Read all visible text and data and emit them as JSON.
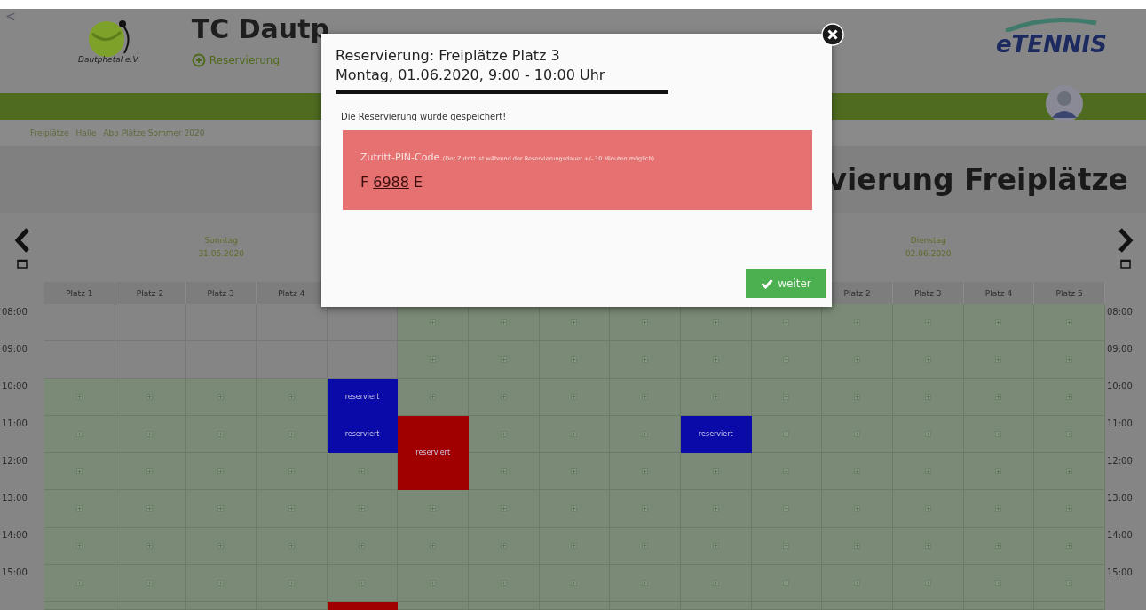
{
  "header": {
    "back": "<",
    "logo_text": "Dautphetal e.V.",
    "club_name": "TC Dautp",
    "nav_link": "Reservierung",
    "brand": "eTENNIS"
  },
  "breadcrumbs": [
    "Freiplätze",
    "Halle",
    "Abo Plätze Sommer 2020"
  ],
  "page_title": "vierung Freiplätze",
  "calendar": {
    "days": [
      {
        "weekday": "Sonntag",
        "date": "31.05.2020",
        "courts": [
          "Platz 1",
          "Platz 2",
          "Platz 3",
          "Platz 4"
        ]
      },
      {
        "weekday": "Dienstag",
        "date": "02.06.2020",
        "courts": [
          "Platz 2",
          "Platz 3",
          "Platz 4",
          "Platz 5"
        ]
      }
    ],
    "rows": [
      {
        "time_left": "08:00",
        "time_right": "08:00",
        "cells": [
          {
            "kind": "past"
          },
          {
            "kind": "past"
          },
          {
            "kind": "past"
          },
          {
            "kind": "past"
          },
          {
            "kind": "past"
          },
          {
            "kind": "free"
          },
          {
            "kind": "free"
          },
          {
            "kind": "free"
          },
          {
            "kind": "free"
          },
          {
            "kind": "free"
          },
          {
            "kind": "free"
          },
          {
            "kind": "free"
          },
          {
            "kind": "free"
          },
          {
            "kind": "free"
          },
          {
            "kind": "free"
          }
        ]
      },
      {
        "time_left": "09:00",
        "time_right": "09:00",
        "cells": [
          {
            "kind": "past"
          },
          {
            "kind": "past"
          },
          {
            "kind": "past"
          },
          {
            "kind": "past"
          },
          {
            "kind": "past"
          },
          {
            "kind": "free"
          },
          {
            "kind": "free"
          },
          {
            "kind": "free"
          },
          {
            "kind": "free"
          },
          {
            "kind": "free"
          },
          {
            "kind": "free"
          },
          {
            "kind": "free"
          },
          {
            "kind": "free"
          },
          {
            "kind": "free"
          },
          {
            "kind": "free"
          }
        ]
      },
      {
        "time_left": "10:00",
        "time_right": "10:00",
        "cells": [
          {
            "kind": "free"
          },
          {
            "kind": "free"
          },
          {
            "kind": "free"
          },
          {
            "kind": "free"
          },
          {
            "kind": "reserved",
            "color": "#0a0aa8",
            "label": "reserviert",
            "tall": false
          },
          {
            "kind": "free"
          },
          {
            "kind": "free"
          },
          {
            "kind": "free"
          },
          {
            "kind": "free"
          },
          {
            "kind": "free"
          },
          {
            "kind": "free"
          },
          {
            "kind": "free"
          },
          {
            "kind": "free"
          },
          {
            "kind": "free"
          },
          {
            "kind": "free"
          }
        ]
      },
      {
        "time_left": "11:00",
        "time_right": "11:00",
        "cells": [
          {
            "kind": "free"
          },
          {
            "kind": "free"
          },
          {
            "kind": "free"
          },
          {
            "kind": "free"
          },
          {
            "kind": "reserved",
            "color": "#0a0aa8",
            "label": "reserviert",
            "tall": false
          },
          {
            "kind": "reserved",
            "color": "#a00000",
            "label": "reserviert",
            "tall": true
          },
          {
            "kind": "free"
          },
          {
            "kind": "free"
          },
          {
            "kind": "free"
          },
          {
            "kind": "reserved",
            "color": "#0a0aa8",
            "label": "reserviert",
            "tall": false
          },
          {
            "kind": "free"
          },
          {
            "kind": "free"
          },
          {
            "kind": "free"
          },
          {
            "kind": "free"
          },
          {
            "kind": "free"
          }
        ]
      },
      {
        "time_left": "12:00",
        "time_right": "12:00",
        "cells": [
          {
            "kind": "free"
          },
          {
            "kind": "free"
          },
          {
            "kind": "free"
          },
          {
            "kind": "free"
          },
          {
            "kind": "free"
          },
          {
            "kind": "covered"
          },
          {
            "kind": "free"
          },
          {
            "kind": "free"
          },
          {
            "kind": "free"
          },
          {
            "kind": "free"
          },
          {
            "kind": "free"
          },
          {
            "kind": "free"
          },
          {
            "kind": "free"
          },
          {
            "kind": "free"
          },
          {
            "kind": "free"
          }
        ]
      },
      {
        "time_left": "13:00",
        "time_right": "13:00",
        "cells": [
          {
            "kind": "free"
          },
          {
            "kind": "free"
          },
          {
            "kind": "free"
          },
          {
            "kind": "free"
          },
          {
            "kind": "free"
          },
          {
            "kind": "free"
          },
          {
            "kind": "free"
          },
          {
            "kind": "free"
          },
          {
            "kind": "free"
          },
          {
            "kind": "free"
          },
          {
            "kind": "free"
          },
          {
            "kind": "free"
          },
          {
            "kind": "free"
          },
          {
            "kind": "free"
          },
          {
            "kind": "free"
          }
        ]
      },
      {
        "time_left": "14:00",
        "time_right": "14:00",
        "cells": [
          {
            "kind": "free"
          },
          {
            "kind": "free"
          },
          {
            "kind": "free"
          },
          {
            "kind": "free"
          },
          {
            "kind": "free"
          },
          {
            "kind": "free"
          },
          {
            "kind": "free"
          },
          {
            "kind": "free"
          },
          {
            "kind": "free"
          },
          {
            "kind": "free"
          },
          {
            "kind": "free"
          },
          {
            "kind": "free"
          },
          {
            "kind": "free"
          },
          {
            "kind": "free"
          },
          {
            "kind": "free"
          }
        ]
      },
      {
        "time_left": "15:00",
        "time_right": "15:00",
        "cells": [
          {
            "kind": "free"
          },
          {
            "kind": "free"
          },
          {
            "kind": "free"
          },
          {
            "kind": "free"
          },
          {
            "kind": "free"
          },
          {
            "kind": "free"
          },
          {
            "kind": "free"
          },
          {
            "kind": "free"
          },
          {
            "kind": "free"
          },
          {
            "kind": "free"
          },
          {
            "kind": "free"
          },
          {
            "kind": "free"
          },
          {
            "kind": "free"
          },
          {
            "kind": "free"
          },
          {
            "kind": "free"
          }
        ]
      },
      {
        "cells": [
          {
            "kind": "blank"
          },
          {
            "kind": "blank"
          },
          {
            "kind": "blank"
          },
          {
            "kind": "blank"
          },
          {
            "kind": "reserved",
            "color": "#a00000"
          },
          {
            "kind": "blank"
          },
          {
            "kind": "blank"
          },
          {
            "kind": "blank"
          },
          {
            "kind": "blank"
          },
          {
            "kind": "blank"
          },
          {
            "kind": "blank"
          },
          {
            "kind": "blank"
          },
          {
            "kind": "blank"
          },
          {
            "kind": "blank"
          },
          {
            "kind": "blank"
          }
        ]
      }
    ]
  },
  "dialog": {
    "title_line_1": "Reservierung: Freiplätze Platz 3",
    "title_line_2": "Montag, 01.06.2020, 9:00 - 10:00 Uhr",
    "message": "Die Reservierung wurde gespeichert!",
    "pin_label": "Zutritt-PIN-Code",
    "pin_note": "(Der Zutritt ist während der Reservierungsdauer +/- 10 Minuten möglich)",
    "pin_prefix": "F",
    "pin_number": "6988",
    "pin_suffix": "E",
    "button": "weiter"
  }
}
